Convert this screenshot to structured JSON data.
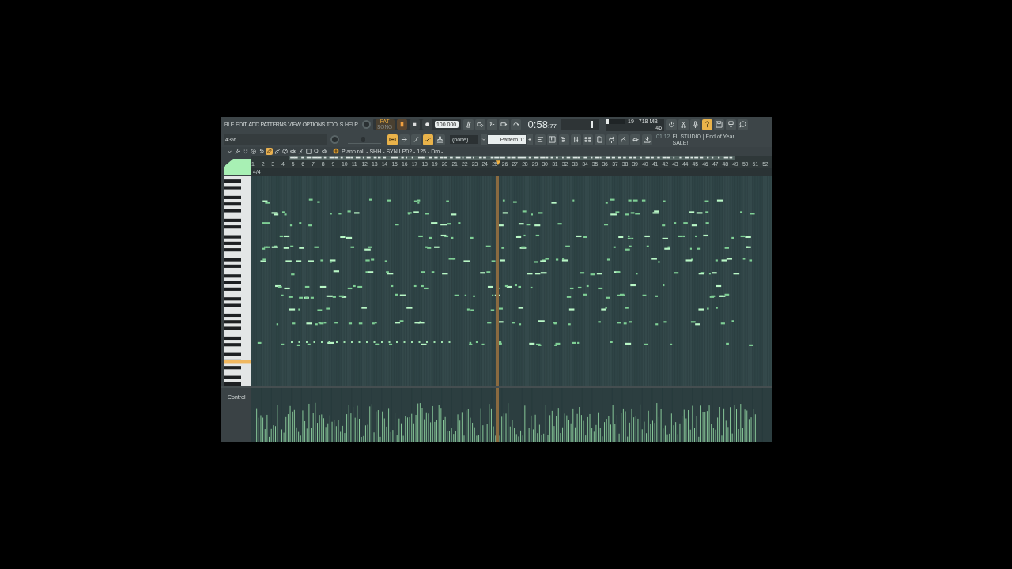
{
  "menu": [
    "FILE",
    "EDIT",
    "ADD",
    "PATTERNS",
    "VIEW",
    "OPTIONS",
    "TOOLS",
    "HELP"
  ],
  "hint": "43%",
  "transport": {
    "mode_top": "PAT",
    "mode_bottom": "SONG",
    "pattern_mode": true,
    "playing": true,
    "recording": false,
    "tempo": "100.000"
  },
  "tools_row1": [
    {
      "kind": "metronome",
      "on": false
    },
    {
      "kind": "wait",
      "on": false
    },
    {
      "kind": "countdown",
      "on": false
    },
    {
      "kind": "step",
      "on": false
    },
    {
      "kind": "loop",
      "on": false
    }
  ],
  "tools_row2": [
    {
      "kind": "typing",
      "on": true
    },
    {
      "kind": "arrow",
      "on": false
    },
    {
      "kind": "curve",
      "on": false
    },
    {
      "kind": "link",
      "on": true
    },
    {
      "kind": "stamp",
      "on": false
    }
  ],
  "time": {
    "main": "0:58",
    "fraction": ":77"
  },
  "master_pitch": {
    "level": 0.85
  },
  "volume": {
    "level": 0.45
  },
  "monitor": {
    "level": 0.12,
    "cpu": "19",
    "memory": "718 MB",
    "polyphony": "46"
  },
  "system_tools": [
    {
      "kind": "power",
      "on": false
    },
    {
      "kind": "cut",
      "on": false
    },
    {
      "kind": "mic",
      "on": false
    },
    {
      "kind": "help",
      "on": true
    },
    {
      "kind": "save",
      "on": false
    },
    {
      "kind": "render",
      "on": false
    },
    {
      "kind": "chat",
      "on": false
    }
  ],
  "pattern": {
    "channel": "(none)",
    "name": "Pattern 1:"
  },
  "windows": [
    {
      "kind": "playlist",
      "on": false
    },
    {
      "kind": "piano",
      "on": false
    },
    {
      "kind": "browser",
      "on": false
    },
    {
      "kind": "mixer",
      "on": false
    },
    {
      "kind": "channels",
      "on": false
    },
    {
      "kind": "file",
      "on": false
    },
    {
      "kind": "plugin",
      "on": false
    },
    {
      "kind": "tree",
      "on": false
    },
    {
      "kind": "turtle",
      "on": false
    },
    {
      "kind": "download",
      "on": false
    }
  ],
  "news": {
    "time": "01:12",
    "text": "FL STUDIO | End of Year SALE!"
  },
  "piano_roll": {
    "tools": [
      {
        "kind": "menu",
        "on": false
      },
      {
        "kind": "wrench",
        "on": false
      },
      {
        "kind": "magnet",
        "on": false
      },
      {
        "kind": "glue",
        "on": false
      },
      {
        "kind": "undo",
        "on": false
      },
      {
        "kind": "draw",
        "on": true
      },
      {
        "kind": "paint",
        "on": false
      },
      {
        "kind": "delete",
        "on": false
      },
      {
        "kind": "mute",
        "on": false
      },
      {
        "kind": "slice",
        "on": false
      },
      {
        "kind": "select",
        "on": false
      },
      {
        "kind": "zoom",
        "on": false
      },
      {
        "kind": "speaker",
        "on": false
      }
    ],
    "title": "Piano roll - SHH - SYN LP02 - 125 - Dm -",
    "time_signature": "4/4",
    "bars": [
      "1",
      "2",
      "3",
      "4",
      "5",
      "6",
      "7",
      "8",
      "9",
      "10",
      "11",
      "12",
      "13",
      "14",
      "15",
      "16",
      "17",
      "18",
      "19",
      "20",
      "21",
      "22",
      "23",
      "24",
      "25",
      "26",
      "27",
      "28",
      "29",
      "30",
      "31",
      "32",
      "33",
      "34",
      "35",
      "36",
      "37",
      "38",
      "39",
      "40",
      "41",
      "42",
      "43",
      "44",
      "45",
      "46",
      "47",
      "48",
      "49",
      "50",
      "51",
      "52"
    ],
    "playhead": {
      "level": 0.47
    },
    "event_target": "Control"
  }
}
